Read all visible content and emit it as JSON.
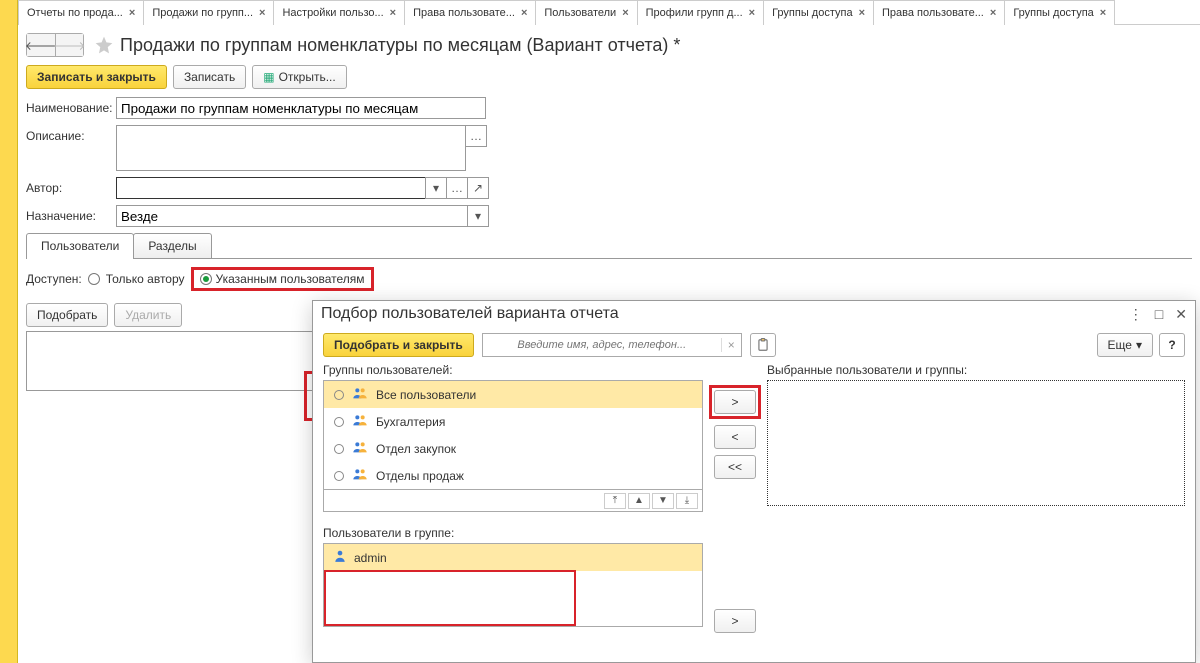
{
  "app_tabs": [
    {
      "label": "Отчеты по прода..."
    },
    {
      "label": "Продажи по групп..."
    },
    {
      "label": "Настройки пользо..."
    },
    {
      "label": "Права пользовате..."
    },
    {
      "label": "Пользователи"
    },
    {
      "label": "Профили групп д..."
    },
    {
      "label": "Группы доступа"
    },
    {
      "label": "Права пользовате..."
    },
    {
      "label": "Группы доступа"
    }
  ],
  "page_title": "Продажи по группам номенклатуры по месяцам (Вариант отчета) *",
  "toolbar": {
    "save_close": "Записать и закрыть",
    "save": "Записать",
    "open": "Открыть..."
  },
  "form": {
    "name_label": "Наименование:",
    "name_value": "Продажи по группам номенклатуры по месяцам",
    "desc_label": "Описание:",
    "desc_value": "",
    "author_label": "Автор:",
    "author_value": "",
    "purpose_label": "Назначение:",
    "purpose_value": "Везде"
  },
  "inner_tabs": {
    "users": "Пользователи",
    "sections": "Разделы"
  },
  "availability": {
    "label": "Доступен:",
    "only_author": "Только автору",
    "specified": "Указанным пользователям"
  },
  "sub_buttons": {
    "pick": "Подобрать",
    "delete": "Удалить"
  },
  "dialog": {
    "title": "Подбор пользователей варианта отчета",
    "pick_close": "Подобрать и закрыть",
    "search_placeholder": "Введите имя, адрес, телефон...",
    "more": "Еще",
    "help": "?",
    "groups_label": "Группы пользователей:",
    "groups": [
      {
        "name": "Все пользователи",
        "selected": true
      },
      {
        "name": "Бухгалтерия",
        "selected": false
      },
      {
        "name": "Отдел закупок",
        "selected": false
      },
      {
        "name": "Отделы продаж",
        "selected": false
      }
    ],
    "move": {
      "r": ">",
      "l": "<",
      "ll": "<<"
    },
    "selected_label": "Выбранные пользователи и группы:",
    "users_in_group_label": "Пользователи в группе:",
    "users": [
      {
        "name": "admin"
      }
    ],
    "move2": {
      "r": ">"
    }
  }
}
